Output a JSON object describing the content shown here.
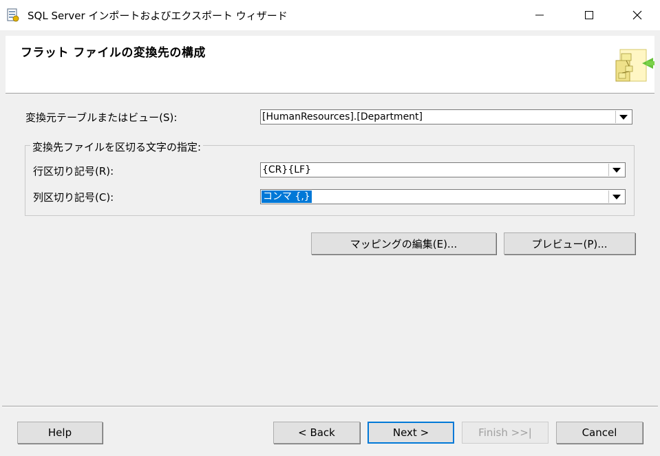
{
  "window": {
    "title": "SQL Server インポートおよびエクスポート ウィザード",
    "minimize_glyph": "—",
    "maximize_glyph": "☐",
    "close_glyph": "✕"
  },
  "header": {
    "title": "フラット ファイルの変換先の構成"
  },
  "source": {
    "label": "変換元テーブルまたはビュー(S):",
    "value": "[HumanResources].[Department]"
  },
  "delimiters": {
    "group_label": "変換先ファイルを区切る文字の指定:",
    "row_label": "行区切り記号(R):",
    "row_value": "{CR}{LF}",
    "column_label": "列区切り記号(C):",
    "column_value": "コンマ {,}"
  },
  "actions": {
    "edit_mappings": "マッピングの編集(E)...",
    "preview": "プレビュー(P)..."
  },
  "footer": {
    "help": "Help",
    "back": "< Back",
    "next": "Next >",
    "finish": "Finish >>|",
    "cancel": "Cancel"
  },
  "colors": {
    "selection": "#0078d7",
    "background": "#f0f0f0"
  }
}
